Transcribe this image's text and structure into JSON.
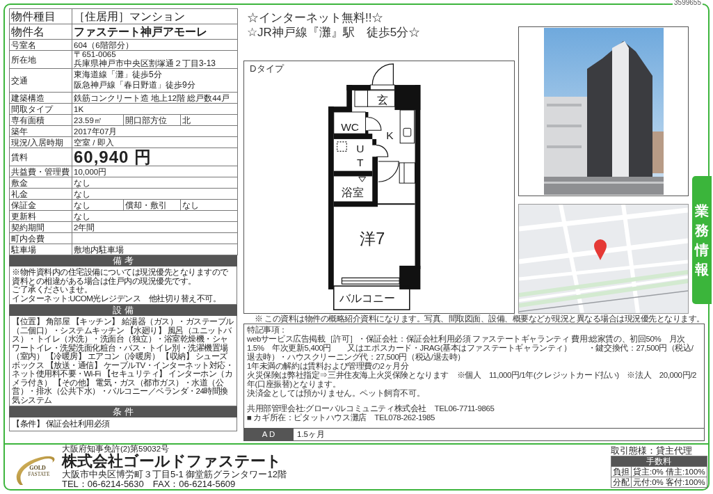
{
  "document_number": "3599655",
  "property_table": {
    "rows": [
      {
        "kind": "large",
        "label": "物件種目",
        "value": "［住居用］マンション"
      },
      {
        "kind": "title",
        "label": "物件名",
        "value": "ファステート神戸アモーレ"
      },
      {
        "kind": "plain",
        "label": "号室名",
        "value": "604（6階部分）"
      },
      {
        "kind": "address",
        "label": "所在地",
        "postal_code": "〒651-0065",
        "value": "兵庫県神戸市中央区割塚通２丁目3-13"
      },
      {
        "kind": "lines",
        "label": "交通",
        "lines": [
          "東海道線「灘」徒歩5分",
          "阪急神戸線「春日野道」徒歩9分"
        ]
      },
      {
        "kind": "plain",
        "label": "建築構造",
        "value": "鉄筋コンクリート造 地上12階 総戸数44戸"
      },
      {
        "kind": "plain",
        "label": "間取タイプ",
        "value": "1K"
      },
      {
        "kind": "pair",
        "label": "専有面積",
        "value": "23.59㎡",
        "label_2": "開口部方位",
        "value_2": "北"
      },
      {
        "kind": "plain",
        "label": "築年",
        "value": "2017年07月"
      },
      {
        "kind": "plain",
        "label": "現況/入居時期",
        "value": "空室 / 即入"
      },
      {
        "kind": "price",
        "label": "賃料",
        "value": "60,940 円"
      },
      {
        "kind": "plain",
        "label": "共益費・管理費",
        "value": "10,000円"
      },
      {
        "kind": "plain",
        "label": "敷金",
        "value": "なし"
      },
      {
        "kind": "plain",
        "label": "礼金",
        "value": "なし"
      },
      {
        "kind": "pair",
        "label": "保証金",
        "value": "なし",
        "label_2": "償却・敷引",
        "value_2": "なし"
      },
      {
        "kind": "plain",
        "label": "更新料",
        "value": "なし"
      },
      {
        "kind": "plain",
        "label": "契約期間",
        "value": "2年間"
      },
      {
        "kind": "plain",
        "label": "町内会費"
      },
      {
        "kind": "plain",
        "label": "駐車場",
        "value": "敷地内駐車場"
      }
    ]
  },
  "sections": [
    {
      "title": "備 考",
      "lines": [
        "※物件資料内の住宅設備については現況優先となりますので",
        "資料との相違がある場合は住戸内の現況優先です。",
        "ご了承くださいませ。",
        "インターネット:UCOM光レジデンス　他社切り替え不可。"
      ]
    },
    {
      "title": "設 備",
      "lines": [
        "【位置】 角部屋 【キッチン】 給湯器（ガス）・ガステーブル（二個口）・システムキッチン 【水廻り】 風呂（ユニットバス）・トイレ（水洗）・洗面台（独立）・浴室乾燥機・シャワートイレ・洗髪洗面化粧台・バス・トイレ別・洗濯機置場（室内） 【冷暖房】 エアコン（冷暖房） 【収納】 シューズボックス 【放送・通信】 ケーブルTV・インターネット対応・ネット使用料不要・Wi-Fi 【セキュリティ】 インターホン（カメラ付き） 【その他】 電気・ガス（都市ガス）・水道（公営）・排水（公共下水）・バルコニー／ベランダ・24時間換気システム"
      ]
    },
    {
      "title": "条 件",
      "lines": [
        "【条件】 保証会社利用必須"
      ]
    }
  ],
  "headline": [
    "☆インターネット無料!!☆",
    "☆JR神戸線『灘』駅　徒歩5分☆"
  ],
  "floor_plan": {
    "type_label": "Dタイプ",
    "rooms": [
      {
        "kind": "label",
        "label": "玄"
      },
      {
        "kind": "label",
        "label": "WC"
      },
      {
        "kind": "label",
        "label": "K"
      },
      {
        "kind": "vertical",
        "label": "UT"
      },
      {
        "kind": "label",
        "label": "浴室"
      },
      {
        "kind": "large",
        "label": "洋7"
      },
      {
        "kind": "label",
        "label": "バルコニー"
      }
    ]
  },
  "side_tab": {
    "label": "業務情報"
  },
  "disclaimer": "※ この資料は物件の概略紹介資料になります。写真、間取図面、設備、概要などが現況と異なる場合は現況優先となります。",
  "special_notes": {
    "blocks": [
      [
        "特記事項：",
        "webサービス広告掲載［許可］・保証会社：保証会社利用必須 ファステートギャランティ 費用:総家賃の、初回50%　月次1.5%　年次更新5,400円　　又はエポスカード・JRAG(基本はファステートギャランティ）　　・鍵交換代：27,500円（税込/退去時）・ハウスクリーニング代：27,500円（税込/退去時）",
        "1年未満の解約は賃料および管理費の2ヶ月分",
        "火災保険は弊社指定⇒三井住友海上火災保険となります　※個人　11,000円/1年(クレジットカード払い)　※法人　20,000円/2年(口座振替)となります。",
        "決済金としては預かりません。ペット飼育不可。"
      ],
      [
        "共用部管理会社:グローバルコミュニティ株式会社　TEL06-7711-9865",
        "■ カギ所在：ピタットハウス灘店　TEL078-262-1985"
      ]
    ]
  },
  "ad": {
    "label": "A D",
    "value": "1.5ヶ月"
  },
  "footer": {
    "license": "大阪府知事免許(2)第59032号",
    "logo_lines": [
      "GOLD",
      "FASTATE"
    ],
    "company": "株式会社ゴールドファステート",
    "address": "大阪市中央区博労町３丁目5-1 御堂筋グランタワー12階",
    "contact": "TEL：06-6214-5630　FAX：06-6214-5609",
    "transaction_type": "取引態様：貸主代理",
    "fee_table": {
      "title": "手数料",
      "rows": [
        {
          "label": "負担",
          "value": "貸主:0% 借主:100%"
        },
        {
          "label": "分配",
          "value": "元付:0% 客付:100%"
        }
      ]
    }
  }
}
